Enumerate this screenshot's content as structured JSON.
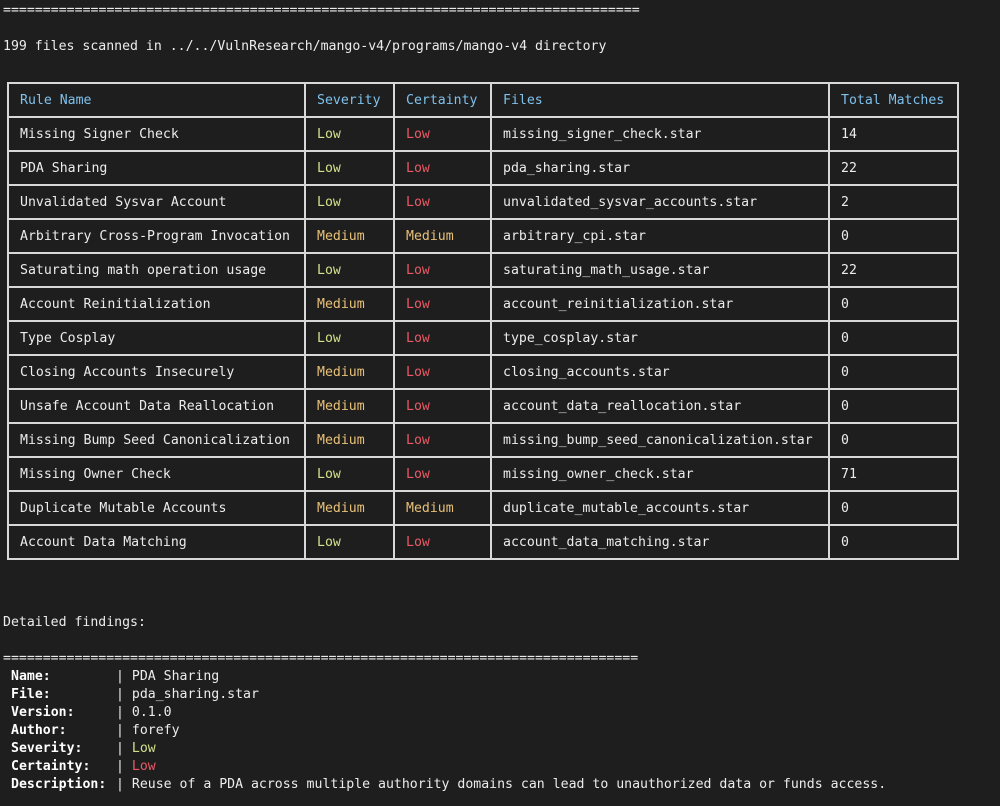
{
  "separator": "================================================================================",
  "scan_summary": "199 files scanned in ../../VulnResearch/mango-v4/programs/mango-v4 directory",
  "table": {
    "headers": [
      "Rule Name",
      "Severity",
      "Certainty",
      "Files",
      "Total Matches"
    ],
    "rows": [
      {
        "name": "Missing Signer Check",
        "severity": "Low",
        "certainty": "Low",
        "file": "missing_signer_check.star",
        "matches": "14"
      },
      {
        "name": "PDA Sharing",
        "severity": "Low",
        "certainty": "Low",
        "file": "pda_sharing.star",
        "matches": "22"
      },
      {
        "name": "Unvalidated Sysvar Account",
        "severity": "Low",
        "certainty": "Low",
        "file": "unvalidated_sysvar_accounts.star",
        "matches": "2"
      },
      {
        "name": "Arbitrary Cross-Program Invocation",
        "severity": "Medium",
        "certainty": "Medium",
        "file": "arbitrary_cpi.star",
        "matches": "0"
      },
      {
        "name": "Saturating math operation usage",
        "severity": "Low",
        "certainty": "Low",
        "file": "saturating_math_usage.star",
        "matches": "22"
      },
      {
        "name": "Account Reinitialization",
        "severity": "Medium",
        "certainty": "Low",
        "file": "account_reinitialization.star",
        "matches": "0"
      },
      {
        "name": "Type Cosplay",
        "severity": "Low",
        "certainty": "Low",
        "file": "type_cosplay.star",
        "matches": "0"
      },
      {
        "name": "Closing Accounts Insecurely",
        "severity": "Medium",
        "certainty": "Low",
        "file": "closing_accounts.star",
        "matches": "0"
      },
      {
        "name": "Unsafe Account Data Reallocation",
        "severity": "Medium",
        "certainty": "Low",
        "file": "account_data_reallocation.star",
        "matches": "0"
      },
      {
        "name": "Missing Bump Seed Canonicalization",
        "severity": "Medium",
        "certainty": "Low",
        "file": "missing_bump_seed_canonicalization.star",
        "matches": "0"
      },
      {
        "name": "Missing Owner Check",
        "severity": "Low",
        "certainty": "Low",
        "file": "missing_owner_check.star",
        "matches": "71"
      },
      {
        "name": "Duplicate Mutable Accounts",
        "severity": "Medium",
        "certainty": "Medium",
        "file": "duplicate_mutable_accounts.star",
        "matches": "0"
      },
      {
        "name": "Account Data Matching",
        "severity": "Low",
        "certainty": "Low",
        "file": "account_data_matching.star",
        "matches": "0"
      }
    ]
  },
  "findings": {
    "title": "Detailed findings:",
    "detail": [
      {
        "key": "Name:",
        "value": "PDA Sharing",
        "style": "plain"
      },
      {
        "key": "File:",
        "value": "pda_sharing.star",
        "style": "plain"
      },
      {
        "key": "Version:",
        "value": "0.1.0",
        "style": "plain"
      },
      {
        "key": "Author:",
        "value": "forefy",
        "style": "plain"
      },
      {
        "key": "Severity:",
        "value": "Low",
        "style": "low-green"
      },
      {
        "key": "Certainty:",
        "value": "Low",
        "style": "low-red"
      },
      {
        "key": "Description:",
        "value": "Reuse of a PDA across multiple authority domains can lead to unauthorized data or funds access.",
        "style": "plain"
      }
    ]
  },
  "colors": {
    "background": "#1e1e1e",
    "header": "#7fc1ec",
    "low_severity": "#d3e08a",
    "low_certainty": "#ea5965",
    "medium": "#e8c177"
  }
}
